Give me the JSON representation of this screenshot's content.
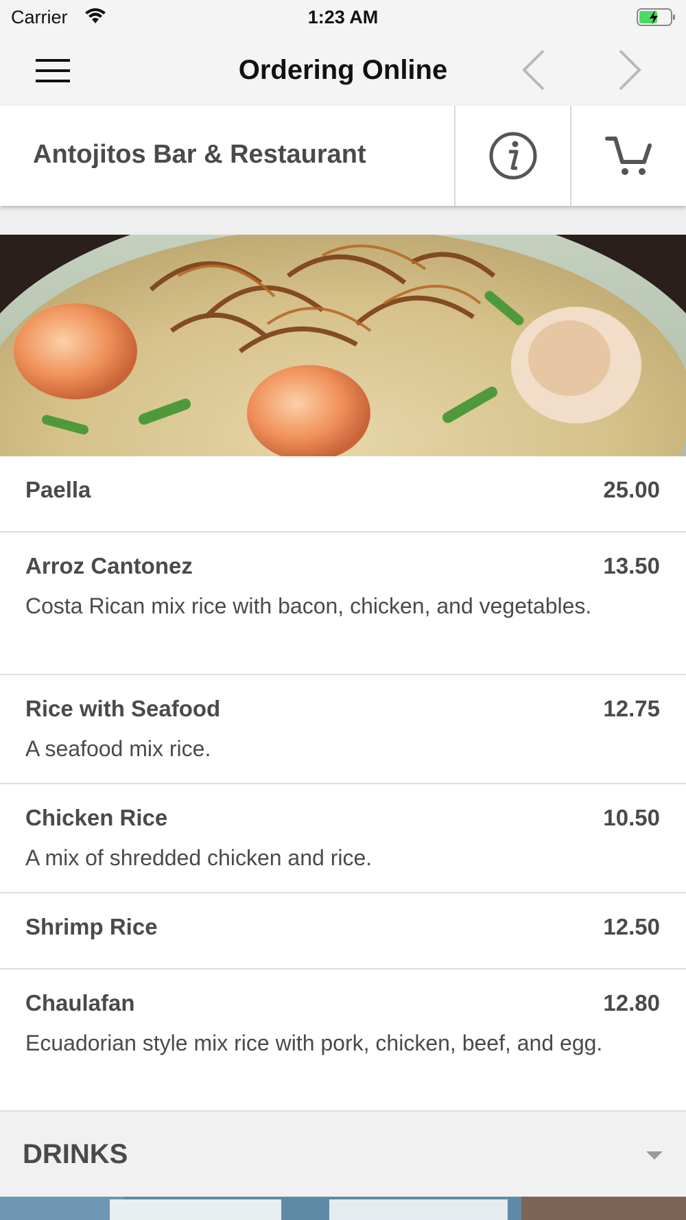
{
  "status_bar": {
    "carrier": "Carrier",
    "time": "1:23 AM"
  },
  "nav": {
    "title": "Ordering Online",
    "icons": [
      "hamburger-menu-icon",
      "chevron-left-icon",
      "chevron-right-icon"
    ]
  },
  "restaurant": {
    "name": "Antojitos Bar & Restaurant",
    "icons": [
      "info-icon",
      "cart-icon"
    ]
  },
  "menu_items": [
    {
      "name": "Paella",
      "price": "25.00",
      "description": ""
    },
    {
      "name": "Arroz Cantonez",
      "price": "13.50",
      "description": "Costa Rican mix rice with bacon, chicken, and vegetables."
    },
    {
      "name": "Rice with Seafood",
      "price": "12.75",
      "description": "A seafood mix rice."
    },
    {
      "name": "Chicken Rice",
      "price": "10.50",
      "description": "A mix of shredded chicken and rice."
    },
    {
      "name": "Shrimp Rice",
      "price": "12.50",
      "description": ""
    },
    {
      "name": "Chaulafan",
      "price": "12.80",
      "description": "Ecuadorian style mix rice with pork, chicken, beef, and egg."
    }
  ],
  "drinks_section": {
    "label": "DRINKS"
  },
  "colors": {
    "bar_background": "#f4f4f4",
    "text": "#4a4a4a",
    "divider": "#dedede",
    "battery_fill": "#4cd964"
  }
}
